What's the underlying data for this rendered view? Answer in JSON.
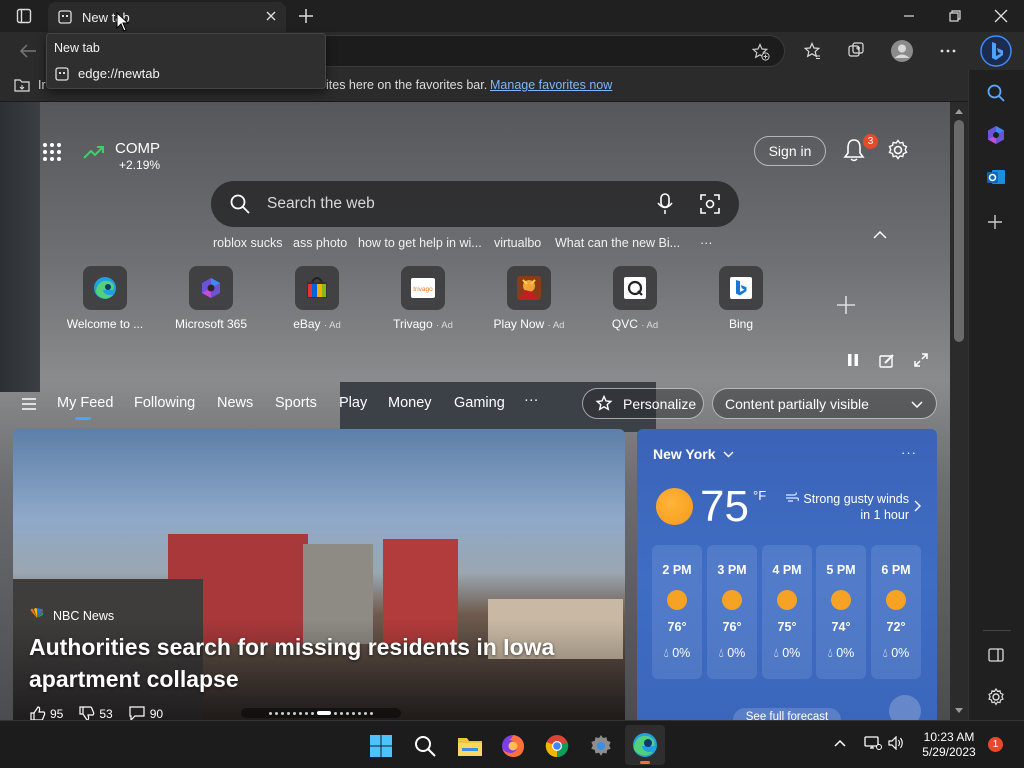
{
  "colors": {
    "accent": "#4fa0ff",
    "frame": "#202020",
    "toolbar": "#2b2b2b",
    "notif": "#e8492c",
    "link": "#7fb6ff"
  },
  "tab": {
    "title": "New tab",
    "icon": "newtab-page-icon",
    "close_icon": "close-icon"
  },
  "tooltip": {
    "title": "New tab",
    "url": "edge://newtab"
  },
  "favbar": {
    "text_left": "Ir",
    "text_right": "ites here on the favorites bar.",
    "link": "Manage favorites now"
  },
  "stock": {
    "symbol": "COMP",
    "change": "+2.19%"
  },
  "signin": "Sign in",
  "notifications": {
    "count": "3"
  },
  "search": {
    "placeholder": "Search the web"
  },
  "suggestions": [
    "roblox sucks",
    "ass photo",
    "how to get help in wi...",
    "virtualbo",
    "What can the new Bi...",
    "···"
  ],
  "tiles": [
    {
      "label": "Welcome to ...",
      "ad": "",
      "icon": "edge-icon"
    },
    {
      "label": "Microsoft 365",
      "ad": "",
      "icon": "m365-icon"
    },
    {
      "label": "eBay",
      "ad": "· Ad",
      "icon": "ebay-icon"
    },
    {
      "label": "Trivago",
      "ad": "· Ad",
      "icon": "trivago-icon"
    },
    {
      "label": "Play Now",
      "ad": "· Ad",
      "icon": "game-icon"
    },
    {
      "label": "QVC",
      "ad": "· Ad",
      "icon": "qvc-icon"
    },
    {
      "label": "Bing",
      "ad": "",
      "icon": "bing-icon"
    }
  ],
  "feed": {
    "tabs": [
      "My Feed",
      "Following",
      "News",
      "Sports",
      "Play",
      "Money",
      "Gaming"
    ],
    "more": "···",
    "personalize": "Personalize",
    "visibility": "Content partially visible"
  },
  "news": {
    "source": "NBC News",
    "headline_1": "Authorities search for missing residents in Iowa",
    "headline_2": "apartment collapse",
    "likes": "95",
    "dislikes": "53",
    "comments": "90"
  },
  "weather": {
    "city": "New York",
    "temp": "75",
    "unit": "°F",
    "alert_1": "Strong gusty winds",
    "alert_2": "in 1 hour",
    "hours": [
      {
        "time": "2 PM",
        "temp": "76°",
        "precip": "0%"
      },
      {
        "time": "3 PM",
        "temp": "76°",
        "precip": "0%"
      },
      {
        "time": "4 PM",
        "temp": "75°",
        "precip": "0%"
      },
      {
        "time": "5 PM",
        "temp": "74°",
        "precip": "0%"
      },
      {
        "time": "6 PM",
        "temp": "72°",
        "precip": "0%"
      }
    ],
    "forecast_link": "See full forecast"
  },
  "taskbar": {
    "time": "10:23 AM",
    "date": "5/29/2023",
    "badge": "1"
  }
}
